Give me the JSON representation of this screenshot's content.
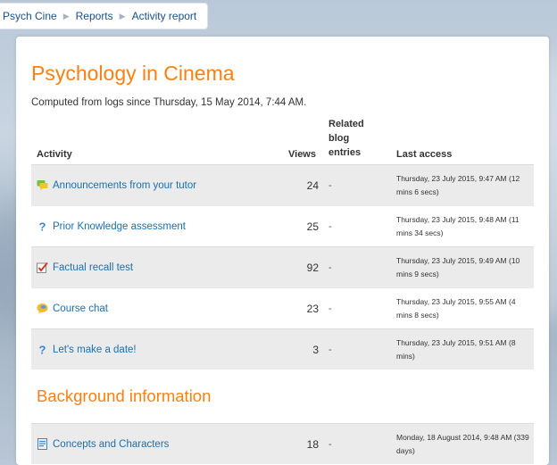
{
  "breadcrumb": {
    "items": [
      "Psych Cine",
      "Reports",
      "Activity report"
    ]
  },
  "course": {
    "title": "Psychology in Cinema",
    "computed_text": "Computed from logs since Thursday, 15 May 2014, 7:44 AM."
  },
  "table": {
    "headers": {
      "activity": "Activity",
      "views": "Views",
      "related": [
        "Related",
        "blog",
        "entries"
      ],
      "last_access": "Last access"
    },
    "rows": [
      {
        "icon": "forum-icon",
        "name": "Announcements from your tutor",
        "views": "24",
        "related": "-",
        "last_access": "Thursday, 23 July 2015, 9:47 AM (12 mins 6 secs)"
      },
      {
        "icon": "question-icon",
        "name": "Prior Knowledge assessment",
        "views": "25",
        "related": "-",
        "last_access": "Thursday, 23 July 2015, 9:48 AM (11 mins 34 secs)"
      },
      {
        "icon": "quiz-icon",
        "name": "Factual recall test",
        "views": "92",
        "related": "-",
        "last_access": "Thursday, 23 July 2015, 9:49 AM (10 mins 9 secs)"
      },
      {
        "icon": "chat-icon",
        "name": "Course chat",
        "views": "23",
        "related": "-",
        "last_access": "Thursday, 23 July 2015, 9:55 AM (4 mins 8 secs)"
      },
      {
        "icon": "question-icon",
        "name": "Let's make a date!",
        "views": "3",
        "related": "-",
        "last_access": "Thursday, 23 July 2015, 9:51 AM (8 mins)"
      }
    ]
  },
  "section": {
    "title": "Background information",
    "rows": [
      {
        "icon": "page-icon",
        "name": "Concepts and Characters",
        "views": "18",
        "related": "-",
        "last_access": "Monday, 18 August 2014, 9:48 AM (339 days)"
      }
    ]
  },
  "colors": {
    "accent": "#f98012",
    "link": "#1a6fb0"
  }
}
